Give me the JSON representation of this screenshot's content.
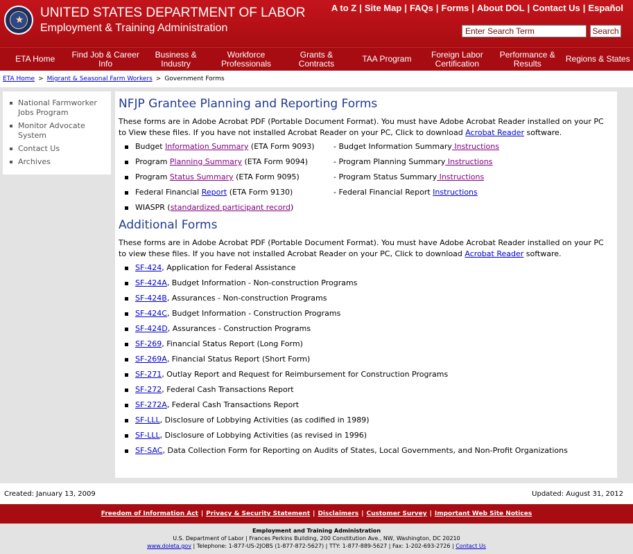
{
  "header": {
    "agency": "UNITED STATES DEPARTMENT OF LABOR",
    "admin": "Employment & Training Administration",
    "top_links": [
      "A to Z",
      "Site Map",
      "FAQs",
      "Forms",
      "About DOL",
      "Contact Us",
      "Español"
    ],
    "search_placeholder": "Enter Search Term",
    "search_button": "Search"
  },
  "nav": [
    "ETA Home",
    "Find Job & Career Info",
    "Business & Industry",
    "Workforce Professionals",
    "Grants & Contracts",
    "TAA Program",
    "Foreign Labor Certification",
    "Performance & Results",
    "Regions & States"
  ],
  "breadcrumb": {
    "items": [
      "ETA Home",
      "Migrant & Seasonal Farm Workers"
    ],
    "current": "Government Forms",
    "sep": ">"
  },
  "sidebar": {
    "items": [
      "National Farmworker Jobs Program",
      "Monitor Advocate System",
      "Contact Us",
      "Archives"
    ]
  },
  "section1": {
    "title": "NFJP Grantee Planning and Reporting Forms",
    "intro": "These forms are in Adobe Acrobat PDF (Portable Document Format). You must have Adobe Acrobat Reader installed on your PC to View these files. If you have not installed Acrobat Reader on your PC, Click to download ",
    "intro_link": "Acrobat Reader",
    "intro_end": " software.",
    "rows": [
      {
        "pre": "Budget ",
        "link": "Information Summary",
        "post": " (ETA Form 9093)",
        "r_pre": "- Budget Information Summary",
        "r_link": " Instructions"
      },
      {
        "pre": "Program ",
        "link": "Planning Summary",
        "post": " (ETA Form 9094)",
        "r_pre": "- Program Planning Summary",
        "r_link": " Instructions"
      },
      {
        "pre": "Program ",
        "link": "Status Summary",
        "post": " (ETA Form 9095)",
        "r_pre": "- Program Status Summary",
        "r_link": " Instructions"
      },
      {
        "pre": "Federal Financial ",
        "link": "Report",
        "post": " (ETA Form 9130)",
        "r_pre": "- Federal Financial Report ",
        "r_link": "Instructions"
      }
    ],
    "wiaspr": {
      "pre": "WIASPR (",
      "link": "standardized participant record",
      "post": ")"
    }
  },
  "section2": {
    "title": "Additional Forms",
    "intro": "These forms are in Adobe Acrobat PDF (Portable Document Format). You must have Adobe Acrobat Reader installed on your PC to view these files. If you have not installed Acrobat Reader on your PC, Click to download ",
    "intro_link": "Acrobat Reader",
    "intro_end": " software.",
    "forms": [
      {
        "link": "SF-424",
        "desc": ", Application for Federal Assistance"
      },
      {
        "link": "SF-424A",
        "desc": ", Budget Information - Non-construction Programs"
      },
      {
        "link": "SF-424B",
        "desc": ", Assurances - Non-construction Programs"
      },
      {
        "link": "SF-424C",
        "desc": ", Budget Information - Construction Programs"
      },
      {
        "link": "SF-424D",
        "desc": ", Assurances - Construction Programs"
      },
      {
        "link": "SF-269",
        "desc": ", Financial Status Report (Long Form)"
      },
      {
        "link": "SF-269A",
        "desc": ", Financial Status Report (Short Form)"
      },
      {
        "link": "SF-271",
        "desc": ", Outlay Report and Request for Reimbursement for Construction Programs"
      },
      {
        "link": "SF-272",
        "desc": ", Federal Cash Transactions Report"
      },
      {
        "link": "SF-272A",
        "desc": ", Federal Cash Transactions Report"
      },
      {
        "link": "SF-LLL",
        "desc": ", Disclosure of Lobbying Activities (as codified in 1989)"
      },
      {
        "link": "SF-LLL",
        "desc": ", Disclosure of Lobbying Activities (as revised in 1996)"
      },
      {
        "link": "SF-SAC",
        "desc": ", Data Collection Form for Reporting on Audits of States, Local Governments, and Non-Profit Organizations"
      }
    ]
  },
  "dates": {
    "created": "Created: January 13, 2009",
    "updated": "Updated: August 31, 2012"
  },
  "footer": {
    "links": [
      "Freedom of Information Act",
      "Privacy & Security Statement",
      "Disclaimers",
      "Customer Survey",
      "Important Web Site Notices"
    ],
    "org": "Employment and Training Administration",
    "address": "U.S. Department of Labor | Frances Perkins Building, 200 Constitution Ave., NW, Washington, DC 20210",
    "site": "www.doleta.gov",
    "phones": " | Telephone: 1-877-US-2JOBS (1-877-872-5627) | TTY: 1-877-889-5627 | Fax: 1-202-693-2726 | ",
    "contact": "Contact Us"
  },
  "colors": {
    "header_red": "#c4141b",
    "nav_red": "#a70c12",
    "title_blue": "#1f3b8c",
    "link_blue": "#0000cc",
    "link_visited": "#800080"
  }
}
